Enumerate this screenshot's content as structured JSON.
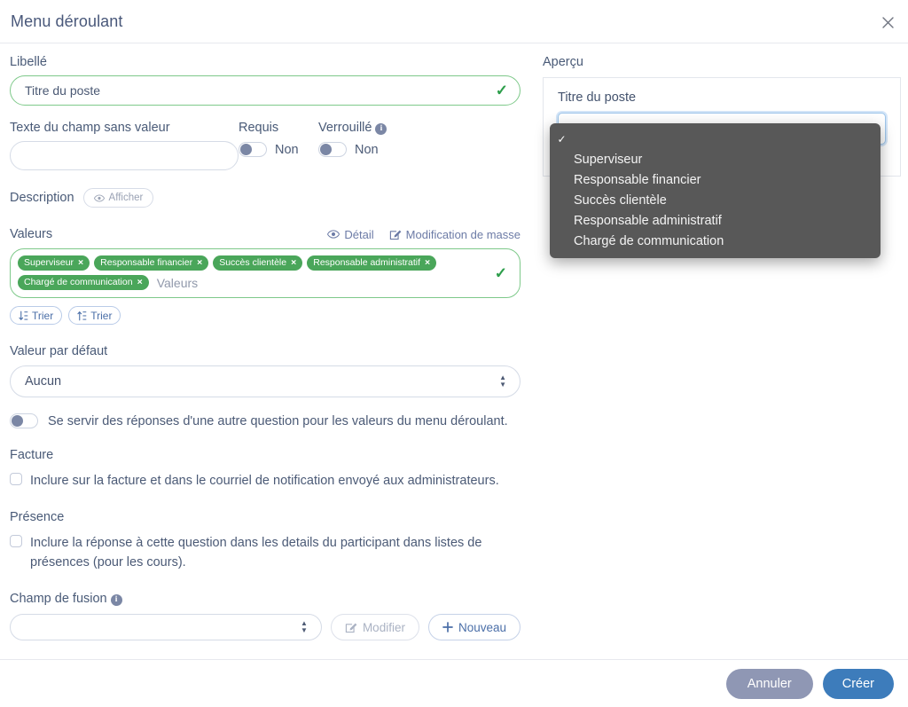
{
  "header": {
    "title": "Menu déroulant",
    "close_icon": "close-icon"
  },
  "form": {
    "label_field": {
      "label": "Libellé",
      "value": "Titre du poste",
      "valid_icon": "check-icon"
    },
    "placeholder_field": {
      "label": "Texte du champ sans valeur",
      "value": ""
    },
    "required": {
      "label": "Requis",
      "state": "Non",
      "on": false
    },
    "locked": {
      "label": "Verrouillé",
      "state": "Non",
      "on": false,
      "info_icon": "info-icon"
    },
    "description": {
      "label": "Description",
      "button_label": "Afficher",
      "button_icon": "eye-icon"
    },
    "values": {
      "label": "Valeurs",
      "detail_label": "Détail",
      "detail_icon": "eye-icon",
      "bulk_edit_label": "Modification de masse",
      "bulk_edit_icon": "edit-square-icon",
      "tags": [
        "Superviseur",
        "Responsable financier",
        "Succès clientèle",
        "Responsable administratif",
        "Chargé de communication"
      ],
      "tag_remove_icon": "×",
      "input_placeholder": "Valeurs",
      "valid_icon": "check-icon",
      "sort_asc_label": "Trier",
      "sort_desc_label": "Trier"
    },
    "default_value": {
      "label": "Valeur par défaut",
      "selected": "Aucun",
      "options": [
        "Aucun"
      ]
    },
    "reuse_answers": {
      "text": "Se servir des réponses d'une autre question pour les valeurs du menu déroulant.",
      "on": false
    },
    "invoice": {
      "title": "Facture",
      "checkbox_label": "Inclure sur la facture et dans le courriel de notification envoyé aux administrateurs.",
      "checked": false
    },
    "attendance": {
      "title": "Présence",
      "checkbox_label": "Inclure la réponse à cette question dans les details du participant dans listes de présences (pour les cours).",
      "checked": false
    },
    "merge_field": {
      "label": "Champ de fusion",
      "info_icon": "info-icon",
      "selected": "",
      "options": [
        ""
      ],
      "edit_label": "Modifier",
      "edit_icon": "edit-square-icon",
      "edit_disabled": true,
      "new_label": "Nouveau",
      "new_icon": "plus-icon"
    }
  },
  "preview": {
    "label": "Aperçu",
    "field_label": "Titre du poste",
    "dropdown": {
      "selected_index": 0,
      "check_glyph": "✓",
      "options": [
        "",
        "Superviseur",
        "Responsable financier",
        "Succès clientèle",
        "Responsable administratif",
        "Chargé de communication"
      ]
    }
  },
  "footer": {
    "cancel_label": "Annuler",
    "create_label": "Créer"
  },
  "colors": {
    "accent_blue": "#3d7cbb",
    "tag_green": "#4aa65a",
    "valid_green": "#7ec98a",
    "cancel_gray": "#8f97b4",
    "dropdown_bg": "#585858"
  }
}
